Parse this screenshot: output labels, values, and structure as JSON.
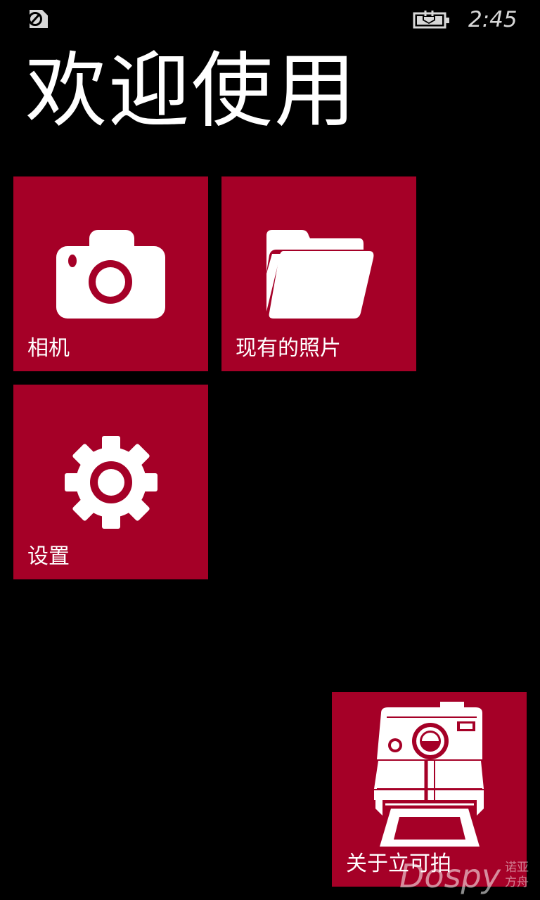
{
  "status_bar": {
    "left_icon": "no-sim-icon",
    "battery_icon": "battery-charging-icon",
    "time": "2:45"
  },
  "page": {
    "title": "欢迎使用"
  },
  "tiles": {
    "camera": {
      "label": "相机",
      "icon": "camera-icon"
    },
    "photos": {
      "label": "现有的照片",
      "icon": "folder-icon"
    },
    "settings": {
      "label": "设置",
      "icon": "gear-icon"
    },
    "about": {
      "label": "关于立可拍",
      "icon": "instant-camera-icon"
    }
  },
  "watermark": {
    "text": "Dospy",
    "sub_line1": "诺亚",
    "sub_line2": "方舟"
  },
  "colors": {
    "background": "#000000",
    "tile": "#a50027",
    "foreground": "#ffffff"
  }
}
